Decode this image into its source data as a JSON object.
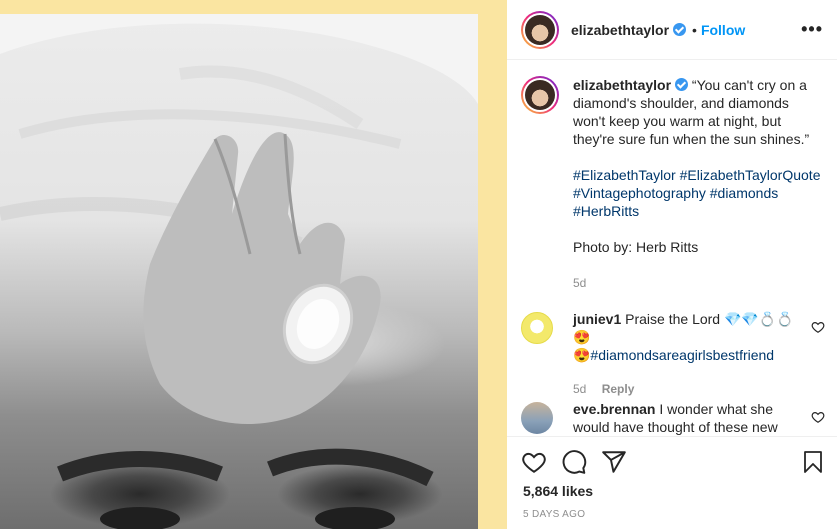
{
  "post": {
    "username": "elizabethtaylor",
    "follow_label": "Follow",
    "separator": "•",
    "more_label": "•••"
  },
  "caption": {
    "username": "elizabethtaylor",
    "quote": "“You can't cry on a diamond's shoulder, and diamonds won't keep you warm at night, but they're sure fun when the sun shines.”",
    "hashtags": [
      "#ElizabethTaylor",
      "#ElizabethTaylorQuote",
      "#Vintagephotography",
      "#diamonds",
      "#HerbRitts"
    ],
    "credit": "Photo by: Herb Ritts",
    "age": "5d"
  },
  "comments": [
    {
      "username": "juniev1",
      "text": "Praise the Lord 💎💎💍💍😍",
      "tag": "😍#diamondsareagirlsbestfriend",
      "age": "5d",
      "reply_label": "Reply"
    },
    {
      "username": "eve.brennan",
      "text": "I wonder what she would have thought of these new",
      "age": "",
      "reply_label": ""
    }
  ],
  "footer": {
    "likes": "5,864 likes",
    "posted": "5 DAYS AGO"
  },
  "icons": [
    "heart-icon",
    "comment-icon",
    "share-icon",
    "bookmark-icon",
    "verified-badge-icon",
    "more-options-icon"
  ],
  "colors": {
    "accent": "#0095f6",
    "verified": "#3897f0",
    "hashtag": "#00376b",
    "photo_border": "#fae5a1"
  }
}
